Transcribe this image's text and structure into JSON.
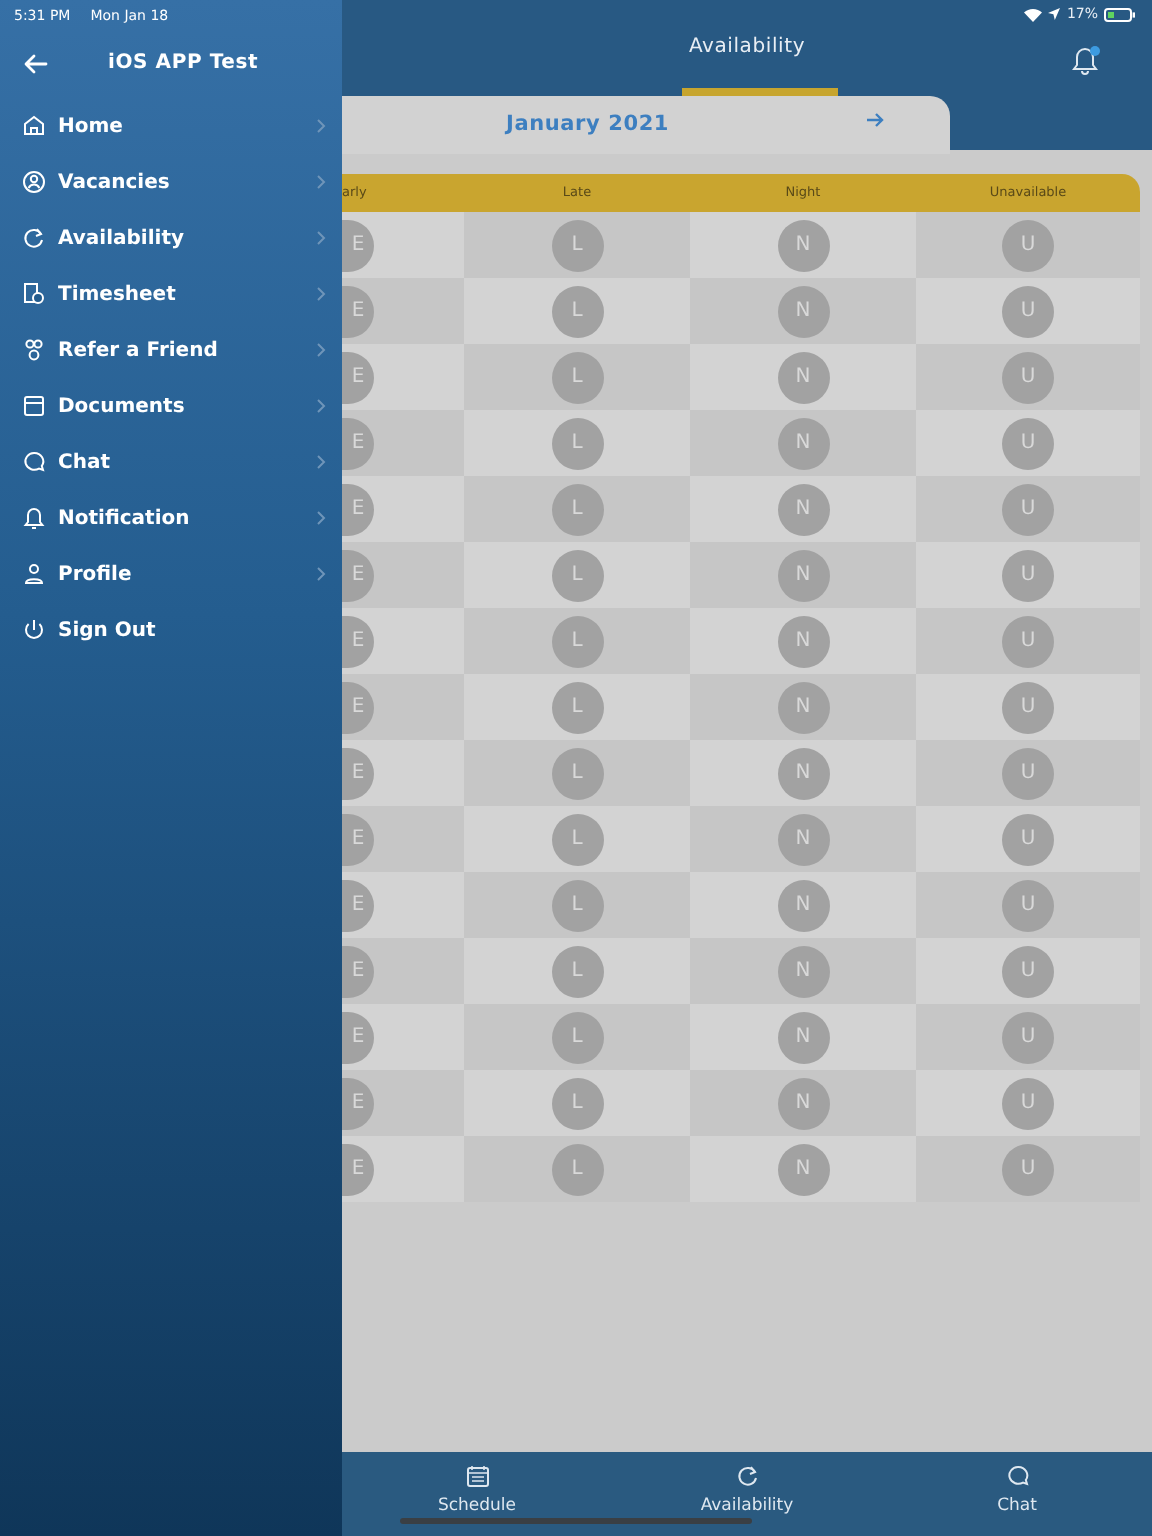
{
  "status_bar": {
    "time": "5:31 PM",
    "date": "Mon Jan 18",
    "battery": "17%"
  },
  "drawer": {
    "title": "iOS APP Test",
    "items": [
      {
        "label": "Home",
        "kind": "nav"
      },
      {
        "label": "Vacancies",
        "kind": "nav"
      },
      {
        "label": "Availability",
        "kind": "nav"
      },
      {
        "label": "Timesheet",
        "kind": "nav"
      },
      {
        "label": "Refer a Friend",
        "kind": "nav"
      },
      {
        "label": "Documents",
        "kind": "nav"
      },
      {
        "label": "Chat",
        "kind": "nav"
      },
      {
        "label": "Notification",
        "kind": "nav"
      },
      {
        "label": "Profile",
        "kind": "nav"
      },
      {
        "label": "Sign Out",
        "kind": "action"
      }
    ]
  },
  "header": {
    "title": "Availability",
    "unread_notifications": true
  },
  "month": {
    "label": "January 2021"
  },
  "table": {
    "columns": [
      "arly",
      "Late",
      "Night",
      "Unavailable"
    ],
    "rows": [
      [
        "E",
        "L",
        "N",
        "U"
      ],
      [
        "E",
        "L",
        "N",
        "U"
      ],
      [
        "E",
        "L",
        "N",
        "U"
      ],
      [
        "E",
        "L",
        "N",
        "U"
      ],
      [
        "E",
        "L",
        "N",
        "U"
      ],
      [
        "E",
        "L",
        "N",
        "U"
      ],
      [
        "E",
        "L",
        "N",
        "U"
      ],
      [
        "E",
        "L",
        "N",
        "U"
      ],
      [
        "E",
        "L",
        "N",
        "U"
      ],
      [
        "E",
        "L",
        "N",
        "U"
      ],
      [
        "E",
        "L",
        "N",
        "U"
      ],
      [
        "E",
        "L",
        "N",
        "U"
      ],
      [
        "E",
        "L",
        "N",
        "U"
      ],
      [
        "E",
        "L",
        "N",
        "U"
      ],
      [
        "E",
        "L",
        "N",
        "U"
      ]
    ]
  },
  "tabs": [
    {
      "label": "Schedule"
    },
    {
      "label": "Availability"
    },
    {
      "label": "Chat"
    }
  ]
}
